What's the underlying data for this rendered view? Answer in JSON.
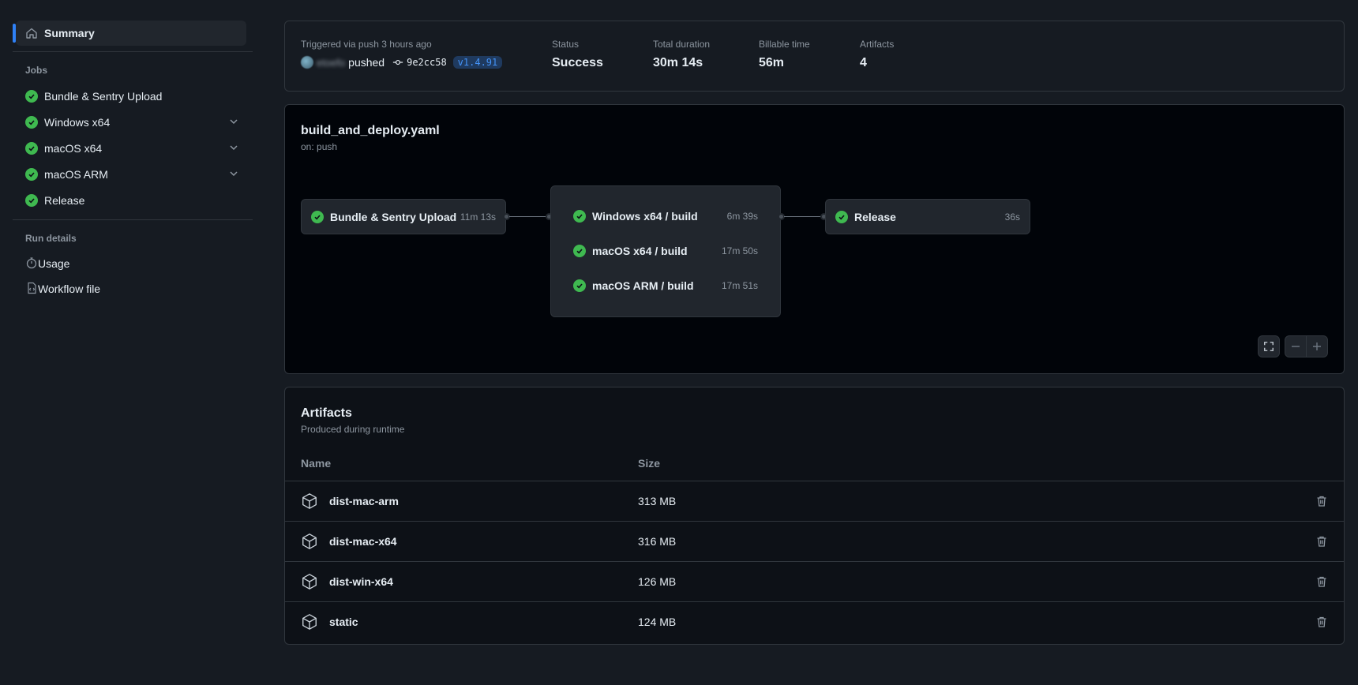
{
  "sidebar": {
    "summary_label": "Summary",
    "jobs_heading": "Jobs",
    "jobs": [
      {
        "label": "Bundle & Sentry Upload",
        "expandable": false
      },
      {
        "label": "Windows x64",
        "expandable": true
      },
      {
        "label": "macOS x64",
        "expandable": true
      },
      {
        "label": "macOS ARM",
        "expandable": true
      },
      {
        "label": "Release",
        "expandable": false
      }
    ],
    "run_details_heading": "Run details",
    "run_details": [
      {
        "label": "Usage",
        "icon": "stopwatch-icon"
      },
      {
        "label": "Workflow file",
        "icon": "file-code-icon"
      }
    ]
  },
  "summary": {
    "trigger_text": "Triggered via push 3 hours ago",
    "actor": "etoefo",
    "action": "pushed",
    "commit": "9e2cc58",
    "tag": "v1.4.91",
    "status_label": "Status",
    "status_value": "Success",
    "duration_label": "Total duration",
    "duration_value": "30m 14s",
    "billable_label": "Billable time",
    "billable_value": "56m",
    "artifacts_label": "Artifacts",
    "artifacts_value": "4"
  },
  "workflow": {
    "file": "build_and_deploy.yaml",
    "trigger": "on: push",
    "first_node": {
      "label": "Bundle & Sentry Upload",
      "duration": "11m 13s"
    },
    "group": [
      {
        "label": "Windows x64 / build",
        "duration": "6m 39s"
      },
      {
        "label": "macOS x64 / build",
        "duration": "17m 50s"
      },
      {
        "label": "macOS ARM / build",
        "duration": "17m 51s"
      }
    ],
    "last_node": {
      "label": "Release",
      "duration": "36s"
    }
  },
  "artifacts": {
    "title": "Artifacts",
    "subtitle": "Produced during runtime",
    "col_name": "Name",
    "col_size": "Size",
    "rows": [
      {
        "name": "dist-mac-arm",
        "size": "313 MB"
      },
      {
        "name": "dist-mac-x64",
        "size": "316 MB"
      },
      {
        "name": "dist-win-x64",
        "size": "126 MB"
      },
      {
        "name": "static",
        "size": "124 MB"
      }
    ]
  },
  "colors": {
    "success": "#3fb950",
    "accent": "#2f81f7",
    "background": "#161b22"
  }
}
